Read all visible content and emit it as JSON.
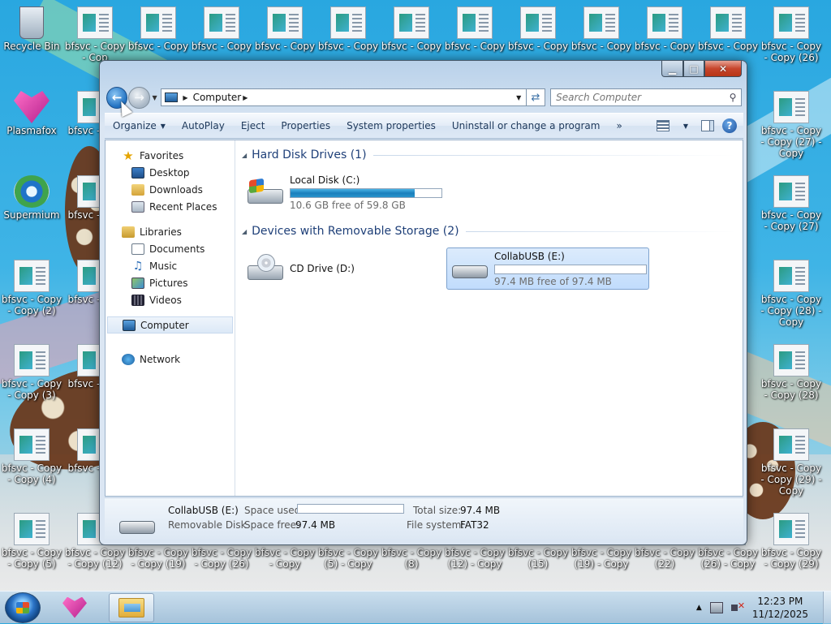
{
  "desktop": {
    "icons_left": [
      {
        "label": "Recycle Bin",
        "icon": "recycle-bin-icon"
      },
      {
        "label": "Plasmafox",
        "icon": "plasmafox-icon"
      },
      {
        "label": "Supermium",
        "icon": "supermium-icon"
      },
      {
        "label": "bfsvc - Copy - Copy (2)",
        "icon": "file-icon"
      },
      {
        "label": "bfsvc - Copy - Copy (3)",
        "icon": "file-icon"
      },
      {
        "label": "bfsvc - Copy - Copy (4)",
        "icon": "file-icon"
      },
      {
        "label": "bfsvc - Copy - Copy (5)",
        "icon": "file-icon"
      }
    ],
    "icons_col2": [
      {
        "label": "bfsvc - Copy - Cop"
      },
      {
        "label": "bfsvc - Cop"
      },
      {
        "label": "bfsvc - Cop"
      },
      {
        "label": "bfsvc - Cop"
      },
      {
        "label": "bfsvc - Cop"
      },
      {
        "label": "bfsvc - Cop"
      },
      {
        "label": "bfsvc - Copy - Copy (12)"
      }
    ],
    "icons_top": [
      "bfsvc - Copy",
      "bfsvc - Copy",
      "bfsvc - Copy",
      "bfsvc - Copy",
      "bfsvc - Copy",
      "bfsvc - Copy",
      "bfsvc - Copy",
      "bfsvc - Copy",
      "bfsvc - Copy",
      "bfsvc - Copy",
      "bfsvc - Copy - Copy (26)"
    ],
    "icons_right": [
      "bfsvc - Copy - Copy (27) - Copy",
      "bfsvc - Copy - Copy (27)",
      "bfsvc - Copy - Copy (28) - Copy",
      "bfsvc - Copy - Copy (28)",
      "bfsvc - Copy - Copy (29) - Copy",
      "bfsvc - Copy - Copy (29)"
    ],
    "icons_bottom": [
      "bfsvc - Copy - Copy (19)",
      "bfsvc - Copy - Copy (26)",
      "bfsvc - Copy - Copy",
      "bfsvc - Copy (5) - Copy",
      "bfsvc - Copy (8)",
      "bfsvc - Copy (12) - Copy",
      "bfsvc - Copy (15)",
      "bfsvc - Copy (19) - Copy",
      "bfsvc - Copy (22)",
      "bfsvc - Copy (26) - Copy"
    ]
  },
  "window": {
    "caption": {
      "minimize": "▁",
      "maximize": "□",
      "close": "✕"
    },
    "address": {
      "crumb": "Computer"
    },
    "search": {
      "placeholder": "Search Computer"
    },
    "commands": [
      "AutoPlay",
      "Eject",
      "Properties",
      "System properties",
      "Uninstall or change a program"
    ],
    "organize_label": "Organize",
    "more_label": "»",
    "sidebar": {
      "favorites": {
        "label": "Favorites",
        "items": [
          "Desktop",
          "Downloads",
          "Recent Places"
        ]
      },
      "libraries": {
        "label": "Libraries",
        "items": [
          "Documents",
          "Music",
          "Pictures",
          "Videos"
        ]
      },
      "computer": "Computer",
      "network": "Network"
    },
    "groups": {
      "hdd": {
        "title": "Hard Disk Drives (1)",
        "drives": [
          {
            "name": "Local Disk (C:)",
            "free_text": "10.6 GB free of 59.8 GB",
            "used_fraction": 0.82
          }
        ]
      },
      "removable": {
        "title": "Devices with Removable Storage (2)",
        "drives": [
          {
            "name": "CD Drive (D:)"
          },
          {
            "name": "CollabUSB (E:)",
            "free_text": "97.4 MB free of 97.4 MB",
            "used_fraction": 0.0
          }
        ]
      }
    },
    "details": {
      "name": "CollabUSB (E:)",
      "type": "Removable Disk",
      "space_used_label": "Space used:",
      "space_free_label": "Space free:",
      "space_free_value": "97.4 MB",
      "total_size_label": "Total size:",
      "total_size_value": "97.4 MB",
      "file_system_label": "File system:",
      "file_system_value": "FAT32",
      "used_fraction": 0.0
    }
  },
  "taskbar": {
    "clock_time": "12:23 PM",
    "clock_date": "11/12/2025",
    "tray_arrow": "▲"
  }
}
